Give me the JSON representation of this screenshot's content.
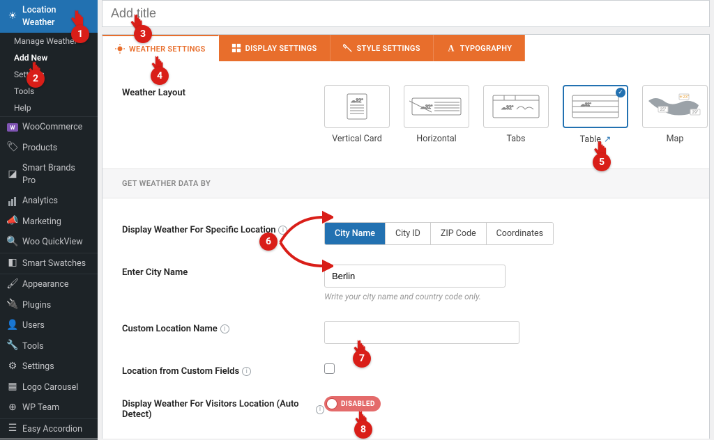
{
  "sidebar": {
    "header": "Location Weather",
    "subs": [
      "Manage Weather",
      "Add New",
      "Settings",
      "Tools",
      "Help"
    ],
    "items": [
      {
        "icon": "W",
        "label": "WooCommerce"
      },
      {
        "icon": "tag",
        "label": "Products"
      },
      {
        "icon": "sbp",
        "label": "Smart Brands Pro"
      },
      {
        "icon": "bars",
        "label": "Analytics"
      },
      {
        "icon": "mega",
        "label": "Marketing"
      },
      {
        "icon": "lens",
        "label": "Woo QuickView"
      },
      {
        "icon": "swatch",
        "label": "Smart Swatches"
      },
      {
        "icon": "brush",
        "label": "Appearance"
      },
      {
        "icon": "plug",
        "label": "Plugins"
      },
      {
        "icon": "user",
        "label": "Users"
      },
      {
        "icon": "wrench",
        "label": "Tools"
      },
      {
        "icon": "sliders",
        "label": "Settings"
      },
      {
        "icon": "logo",
        "label": "Logo Carousel"
      },
      {
        "icon": "team",
        "label": "WP Team"
      },
      {
        "icon": "accordion",
        "label": "Easy Accordion"
      }
    ]
  },
  "title_placeholder": "Add title",
  "tabs": [
    "WEATHER SETTINGS",
    "DISPLAY SETTINGS",
    "STYLE SETTINGS",
    "TYPOGRAPHY"
  ],
  "layout_label": "Weather Layout",
  "layouts": [
    "Vertical Card",
    "Horizontal",
    "Tabs",
    "Table",
    "Map"
  ],
  "section_head": "GET WEATHER DATA BY",
  "fields": {
    "specific": "Display Weather For Specific Location",
    "seg": [
      "City Name",
      "City ID",
      "ZIP Code",
      "Coordinates"
    ],
    "city_label": "Enter City Name",
    "city_value": "Berlin",
    "city_help": "Write your city name and country code only.",
    "custom_loc": "Custom Location Name",
    "custom_fields": "Location from Custom Fields",
    "auto_detect": "Display Weather For Visitors Location (Auto Detect)",
    "toggle_text": "DISABLED"
  },
  "anno": [
    "1",
    "2",
    "3",
    "4",
    "5",
    "6",
    "7",
    "8"
  ]
}
